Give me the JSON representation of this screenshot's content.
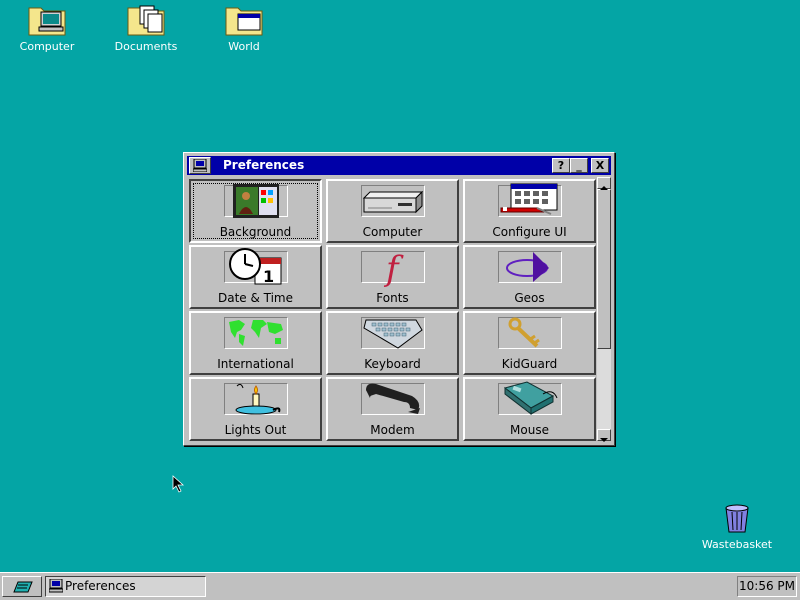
{
  "desktop": {
    "background_color": "#04a5a5",
    "icons": [
      {
        "label": "Computer",
        "icon": "computer-folder-icon"
      },
      {
        "label": "Documents",
        "icon": "documents-folder-icon"
      },
      {
        "label": "World",
        "icon": "world-folder-icon"
      },
      {
        "label": "Wastebasket",
        "icon": "wastebasket-icon"
      }
    ]
  },
  "window": {
    "title": "Preferences",
    "title_color": "#0000a8",
    "buttons": {
      "help": "?",
      "minimize": "_",
      "close": "X"
    },
    "items": [
      {
        "label": "Background",
        "icon": "background-picture-icon",
        "selected": true
      },
      {
        "label": "Computer",
        "icon": "computer-box-icon",
        "selected": false
      },
      {
        "label": "Configure UI",
        "icon": "configure-ui-icon",
        "selected": false
      },
      {
        "label": "Date & Time",
        "icon": "clock-calendar-icon",
        "selected": false
      },
      {
        "label": "Fonts",
        "icon": "font-f-icon",
        "selected": false
      },
      {
        "label": "Geos",
        "icon": "geos-logo-icon",
        "selected": false
      },
      {
        "label": "International",
        "icon": "world-map-icon",
        "selected": false
      },
      {
        "label": "Keyboard",
        "icon": "keyboard-icon",
        "selected": false
      },
      {
        "label": "KidGuard",
        "icon": "key-icon",
        "selected": false
      },
      {
        "label": "Lights Out",
        "icon": "candle-icon",
        "selected": false
      },
      {
        "label": "Modem",
        "icon": "telephone-icon",
        "selected": false
      },
      {
        "label": "Mouse",
        "icon": "mouse-icon",
        "selected": false
      }
    ]
  },
  "taskbar": {
    "tasks": [
      {
        "label": "Preferences"
      }
    ],
    "clock": "10:56 PM"
  }
}
